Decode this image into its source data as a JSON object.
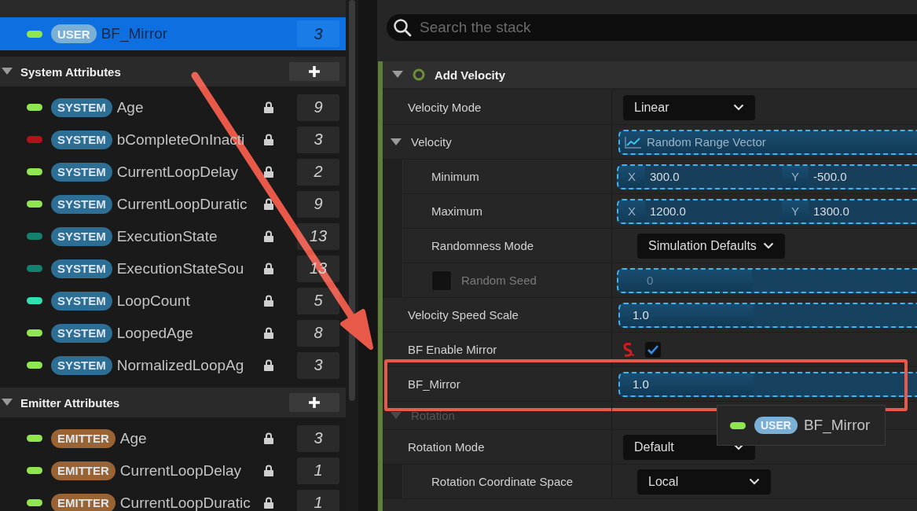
{
  "parameters": {
    "sections": [
      {
        "items": [
          {
            "tag": "USER",
            "kind": "user",
            "name": "BF_Mirror",
            "color": "#8fe650",
            "locked": false,
            "count": "3",
            "selected": true
          }
        ]
      },
      {
        "title": "System Attributes",
        "expanded": true,
        "items": [
          {
            "tag": "SYSTEM",
            "kind": "system",
            "name": "Age",
            "color": "#8fe650",
            "locked": true,
            "count": "9",
            "selected": false
          },
          {
            "tag": "SYSTEM",
            "kind": "system",
            "name": "bCompleteOnInacti",
            "color": "#b3121a",
            "locked": true,
            "count": "3",
            "selected": false
          },
          {
            "tag": "SYSTEM",
            "kind": "system",
            "name": "CurrentLoopDelay",
            "color": "#8fe650",
            "locked": true,
            "count": "2",
            "selected": false
          },
          {
            "tag": "SYSTEM",
            "kind": "system",
            "name": "CurrentLoopDuratic",
            "color": "#8fe650",
            "locked": true,
            "count": "9",
            "selected": false
          },
          {
            "tag": "SYSTEM",
            "kind": "system",
            "name": "ExecutionState",
            "color": "#14806e",
            "locked": true,
            "count": "13",
            "selected": false
          },
          {
            "tag": "SYSTEM",
            "kind": "system",
            "name": "ExecutionStateSou",
            "color": "#14806e",
            "locked": true,
            "count": "13",
            "selected": false
          },
          {
            "tag": "SYSTEM",
            "kind": "system",
            "name": "LoopCount",
            "color": "#2fe0b0",
            "locked": true,
            "count": "5",
            "selected": false
          },
          {
            "tag": "SYSTEM",
            "kind": "system",
            "name": "LoopedAge",
            "color": "#8fe650",
            "locked": true,
            "count": "8",
            "selected": false
          },
          {
            "tag": "SYSTEM",
            "kind": "system",
            "name": "NormalizedLoopAg",
            "color": "#8fe650",
            "locked": true,
            "count": "3",
            "selected": false
          }
        ]
      },
      {
        "title": "Emitter Attributes",
        "expanded": true,
        "items": [
          {
            "tag": "EMITTER",
            "kind": "emitter",
            "name": "Age",
            "color": "#8fe650",
            "locked": true,
            "count": "3",
            "selected": false
          },
          {
            "tag": "EMITTER",
            "kind": "emitter",
            "name": "CurrentLoopDelay",
            "color": "#8fe650",
            "locked": true,
            "count": "1",
            "selected": false
          },
          {
            "tag": "EMITTER",
            "kind": "emitter",
            "name": "CurrentLoopDuratic",
            "color": "#8fe650",
            "locked": true,
            "count": "1",
            "selected": false
          }
        ]
      }
    ]
  },
  "stack": {
    "search": {
      "placeholder": "Search the stack"
    },
    "module": {
      "title": "Add Velocity",
      "expanded": true,
      "enabled": true,
      "rows": [
        {
          "kind": "dropdown",
          "label": "Velocity Mode",
          "value": "Linear",
          "highlighted": false
        },
        {
          "kind": "function",
          "label": "Velocity",
          "value": "Random Range Vector",
          "expanded": true,
          "highlighted": false,
          "children": [
            {
              "kind": "vector",
              "label": "Minimum",
              "components": [
                {
                  "axis": "X",
                  "value": "300.0"
                },
                {
                  "axis": "Y",
                  "value": "-500.0"
                }
              ],
              "highlighted": false
            },
            {
              "kind": "vector",
              "label": "Maximum",
              "components": [
                {
                  "axis": "X",
                  "value": "1200.0"
                },
                {
                  "axis": "Y",
                  "value": "1300.0"
                }
              ],
              "highlighted": false
            },
            {
              "kind": "dropdown",
              "label": "Randomness Mode",
              "value": "Simulation Defaults",
              "highlighted": false
            },
            {
              "kind": "seed",
              "label": "Random Seed",
              "value": "0",
              "checked": false,
              "disabled": true,
              "highlighted": false
            }
          ]
        },
        {
          "kind": "number",
          "label": "Velocity Speed Scale",
          "value": "1.0",
          "highlighted": false
        },
        {
          "kind": "checkbox",
          "label": "BF Enable Mirror",
          "checked": true,
          "highlighted": false
        },
        {
          "kind": "number",
          "label": "BF_Mirror",
          "value": "1.0",
          "highlighted": true
        },
        {
          "kind": "section",
          "label": "Rotation",
          "expanded": true,
          "highlighted": false
        },
        {
          "kind": "dropdown",
          "label": "Rotation Mode",
          "value": "Default",
          "highlighted": false,
          "children": [
            {
              "kind": "dropdown",
              "label": "Rotation Coordinate Space",
              "value": "Local",
              "highlighted": false
            }
          ]
        }
      ]
    }
  },
  "drag_tooltip": {
    "tag": "USER",
    "kind": "user",
    "name": "BF_Mirror",
    "color": "#8fe650"
  }
}
